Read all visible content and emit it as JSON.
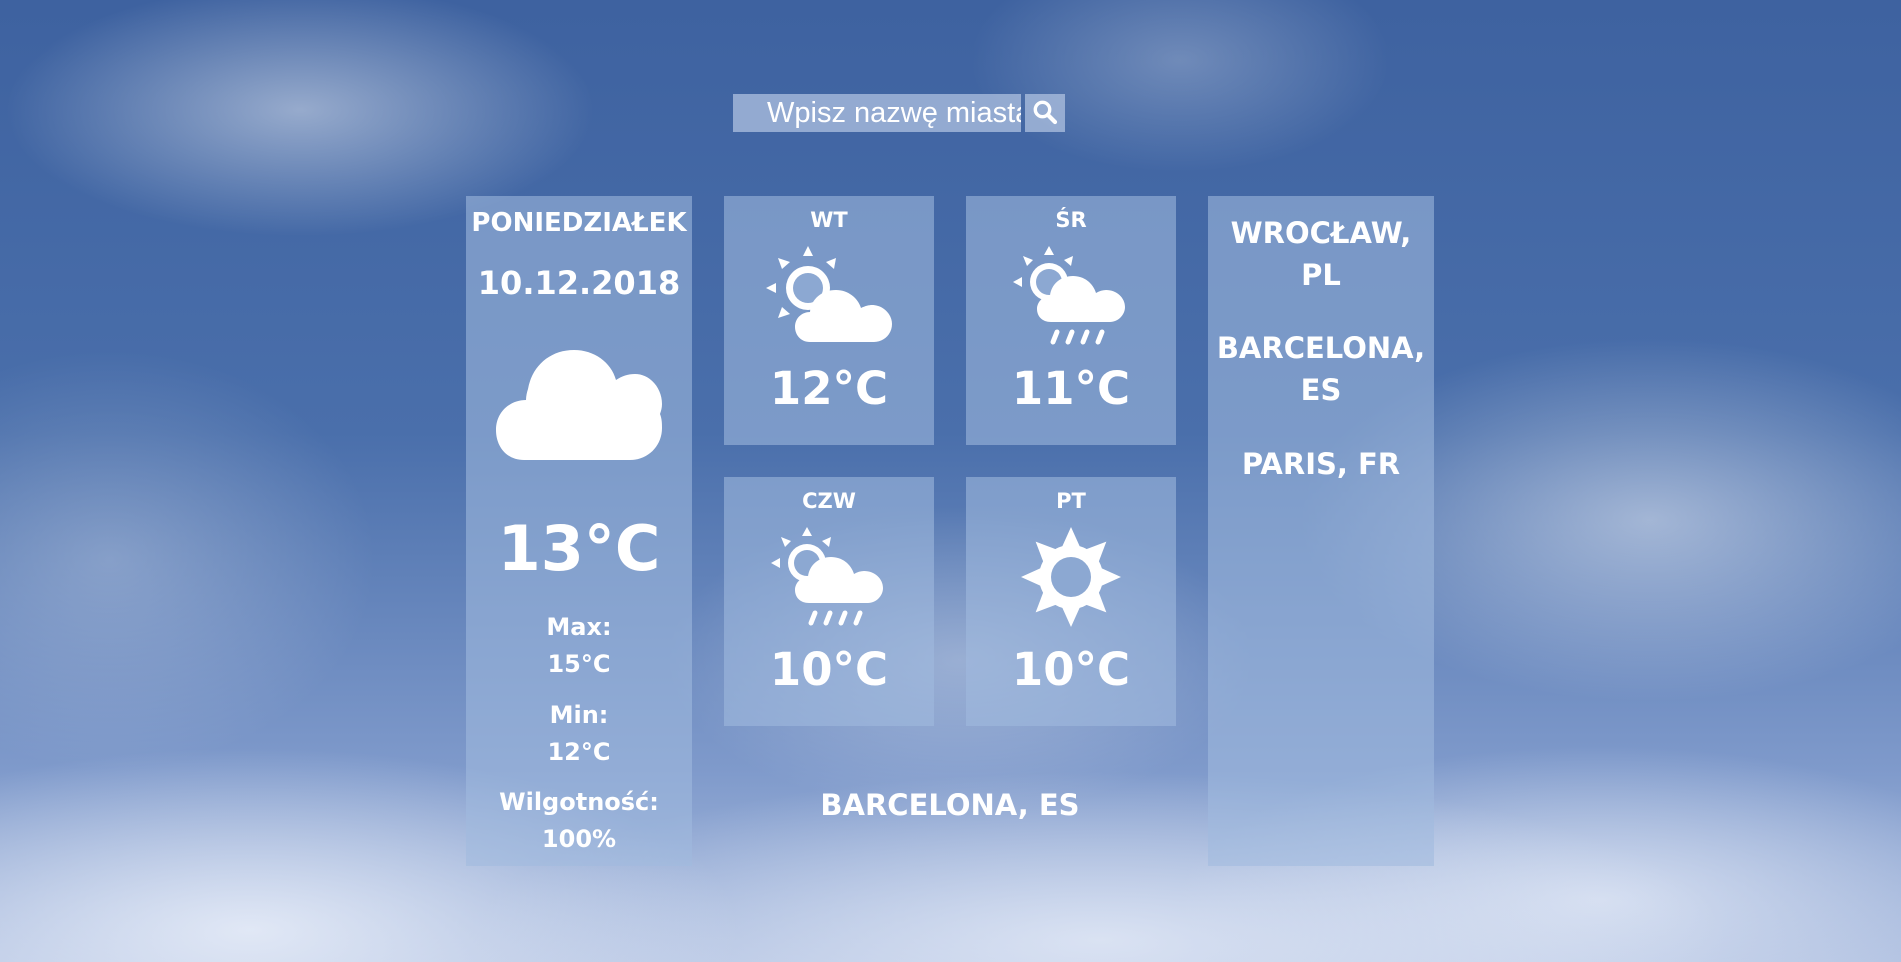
{
  "search": {
    "placeholder": "Wpisz nazwę miasta...",
    "icon": "search-icon"
  },
  "today": {
    "day": "PONIEDZIAŁEK",
    "date": "10.12.2018",
    "icon": "cloud-icon",
    "temp": "13°C",
    "max_label": "Max:",
    "max_value": "15°C",
    "min_label": "Min:",
    "min_value": "12°C",
    "humidity_label": "Wilgotność:",
    "humidity_value": "100%"
  },
  "forecast": [
    {
      "day": "WT",
      "icon": "partly-cloudy-icon",
      "temp": "12°C"
    },
    {
      "day": "ŚR",
      "icon": "sun-cloud-rain-icon",
      "temp": "11°C"
    },
    {
      "day": "CZW",
      "icon": "sun-cloud-rain-icon",
      "temp": "10°C"
    },
    {
      "day": "PT",
      "icon": "sun-icon",
      "temp": "10°C"
    }
  ],
  "current_city": "BARCELONA, ES",
  "cities": [
    {
      "line1": "WROCŁAW,",
      "line2": "PL"
    },
    {
      "line1": "BARCELONA,",
      "line2": "ES"
    },
    {
      "line1": "PARIS, FR",
      "line2": ""
    }
  ],
  "colors": {
    "panel": "#a0badecc",
    "text": "#ffffff",
    "sky": "#4a6fab"
  }
}
